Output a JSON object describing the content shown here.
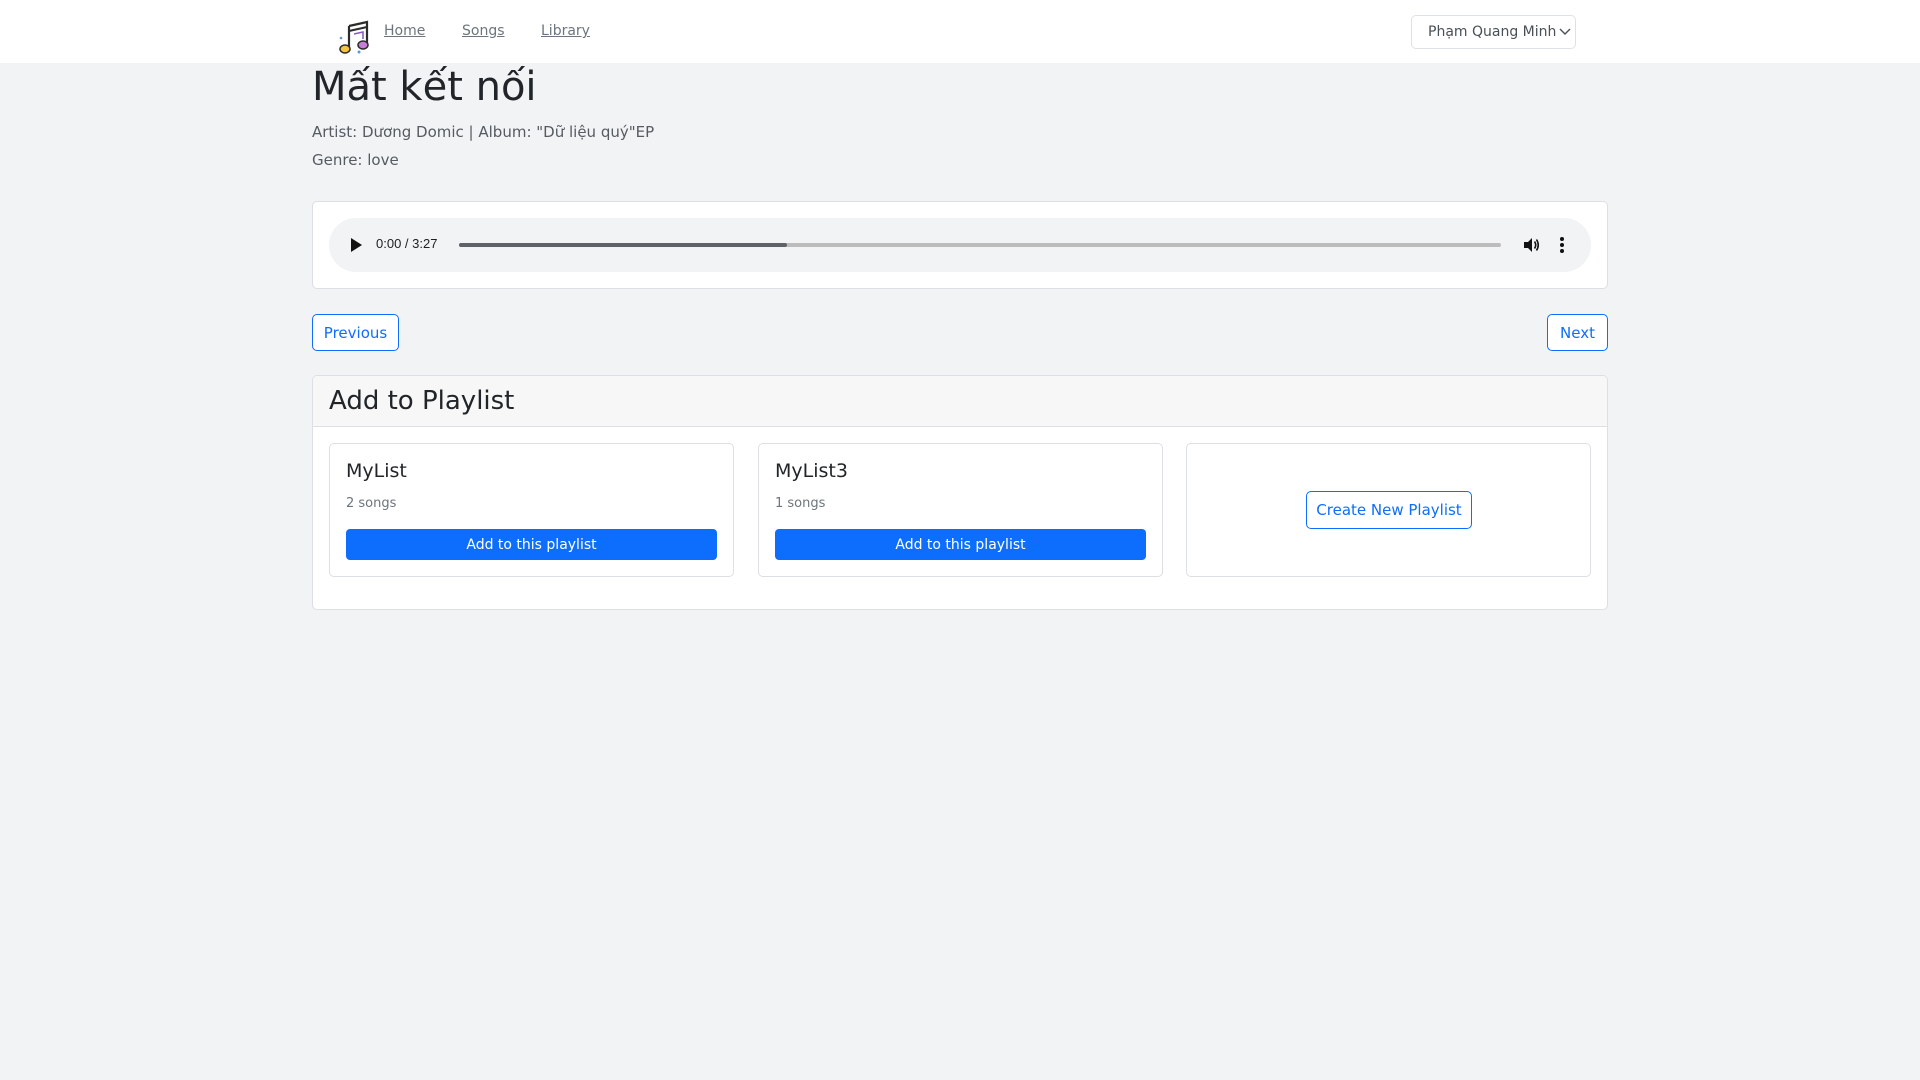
{
  "nav": {
    "links": [
      "Home",
      "Songs",
      "Library"
    ],
    "user_name": "Phạm Quang Minh"
  },
  "song": {
    "title": "Mất kết nối",
    "meta_line": "Artist: Dương Domic | Album: \"Dữ liệu quý\"EP",
    "genre_line": "Genre: love"
  },
  "player": {
    "time": "0:00 / 3:27",
    "buffered_fraction": 0.315
  },
  "buttons": {
    "previous": "Previous",
    "next": "Next"
  },
  "playlist_section": {
    "title": "Add to Playlist",
    "playlists": [
      {
        "name": "MyList",
        "count": "2 songs",
        "action": "Add to this playlist"
      },
      {
        "name": "MyList3",
        "count": "1 songs",
        "action": "Add to this playlist"
      }
    ],
    "create_label": "Create New Playlist"
  },
  "colors": {
    "primary": "#0d6efd",
    "background": "#f2f3f5"
  },
  "icons": [
    "music-notes-logo",
    "chevron-down-icon",
    "play-icon",
    "volume-icon",
    "more-vert-icon"
  ]
}
